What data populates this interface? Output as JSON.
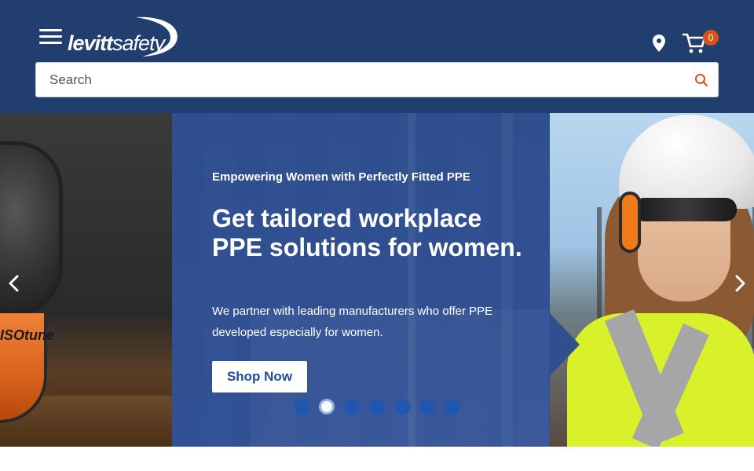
{
  "header": {
    "logo_bold": "levitt",
    "logo_light": "safety",
    "cart_count": "0",
    "icons": [
      "hamburger-menu-icon",
      "location-pin-icon",
      "shopping-cart-icon",
      "search-icon"
    ]
  },
  "search": {
    "placeholder": "Search"
  },
  "hero": {
    "eyebrow": "Empowering Women with Perfectly Fitted PPE",
    "headline": "Get tailored workplace PPE solutions for women.",
    "subcopy": "We partner with leading manufacturers who offer PPE developed especially for women.",
    "cta_label": "Shop Now",
    "earmuff_label": "ISOtune",
    "slide_count": 7,
    "active_slide": 2
  },
  "colors": {
    "header_bg": "#223e6f",
    "hero_overlay": "#2f4e8e",
    "accent_orange": "#d35318",
    "dot_blue": "#1f56b0",
    "cta_text": "#1d4c9a"
  }
}
